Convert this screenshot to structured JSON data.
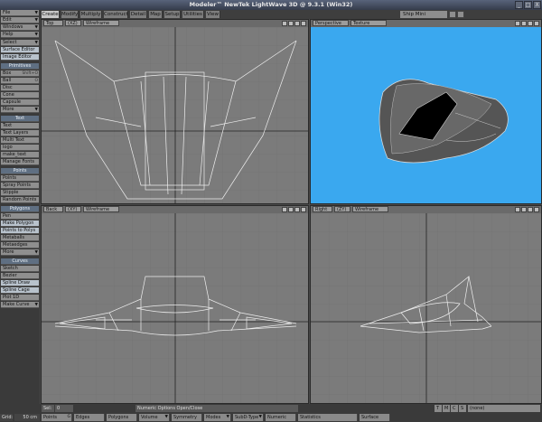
{
  "window": {
    "title": "Modeler™ NewTek LightWave 3D @ 9.3.1 (Win32)",
    "minimize": "_",
    "maximize": "□",
    "close": "X"
  },
  "tabs": [
    "Create",
    "Modify",
    "Multiply",
    "Construct",
    "Detail",
    "Map",
    "Setup",
    "Utilities",
    "View"
  ],
  "layer_select": "Ship Mini",
  "sidebar": {
    "menus": [
      "File",
      "Edit",
      "Windows",
      "Help"
    ],
    "menu_items": [
      "Select",
      "Surface Editor",
      "Image Editor"
    ],
    "sections": [
      {
        "title": "Primitives",
        "items": [
          "Box",
          "Ball",
          "Disc",
          "Cone",
          "Capsule",
          "More"
        ]
      },
      {
        "title": "Text",
        "items": [
          "Text",
          "Text Layers",
          "Multi Text",
          "logo",
          "make_text",
          "Manage Fonts"
        ]
      },
      {
        "title": "Points",
        "items": [
          "Points",
          "Spray Points",
          "Stipple",
          "Random Points"
        ]
      },
      {
        "title": "Polygons",
        "items": [
          "Pen",
          "Make Polygon",
          "Points to Polys",
          "Metaballs",
          "Metaedges",
          "More"
        ]
      },
      {
        "title": "Curves",
        "items": [
          "Sketch",
          "Bezier",
          "Spline Draw",
          "Spline Cage",
          "Plot 1D",
          "Make Curve"
        ]
      }
    ],
    "key_text": "Shift+O",
    "key_ball": "O"
  },
  "viewports": {
    "top": {
      "view": "Top",
      "axis": "(XZ)",
      "mode": "Wireframe"
    },
    "perspective": {
      "view": "Perspective",
      "mode": "Texture",
      "bg_color": "#3aa8ef"
    },
    "back": {
      "view": "Back",
      "axis": "(XY)",
      "mode": "Wireframe"
    },
    "right": {
      "view": "Right",
      "axis": "(ZY)",
      "mode": "Wireframe"
    }
  },
  "statusbar": {
    "sel_label": "Sel:",
    "sel_value": "0",
    "message": "Numeric Options Open/Close",
    "tmcs": [
      "T",
      "M",
      "C",
      "S"
    ],
    "surface_value": "(none)"
  },
  "bottombar": {
    "grid_label": "Grid:",
    "grid_value": "50 cm",
    "mode_points": "Points",
    "key_g": "G",
    "edges": "Edges",
    "polygons": "Polygons",
    "volume": "Volume",
    "symmetry": "Symmetry",
    "modes": "Modes",
    "subd": "SubD-Type",
    "numeric": "Numeric",
    "statistics": "Statistics",
    "surface": "Surface"
  }
}
